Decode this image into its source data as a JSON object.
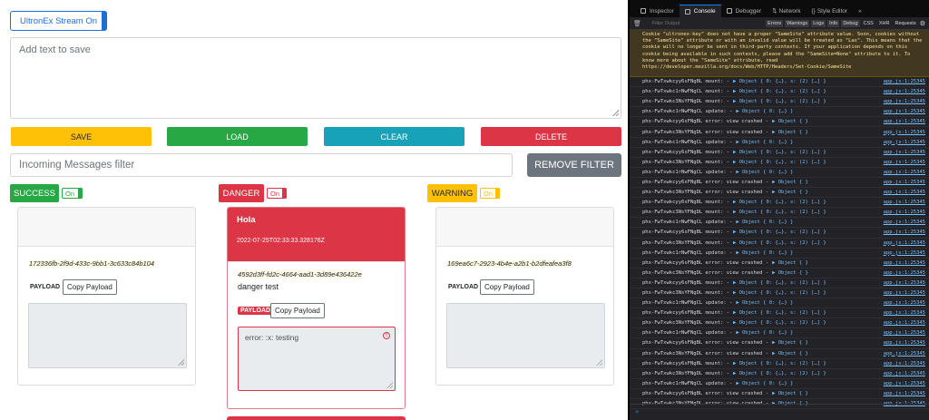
{
  "app": {
    "stream_toggle": "UltronEx Stream On",
    "text_placeholder": "Add text to save",
    "buttons": {
      "save": "SAVE",
      "load": "LOAD",
      "clear": "CLEAR",
      "delete": "DELETE",
      "remove_filter": "REMOVE FILTER"
    },
    "filter_placeholder": "Incoming Messages filter",
    "columns": {
      "success": {
        "label": "SUCCESS",
        "toggle": "On",
        "uuid": "172336fb-2f9d-433c-9bb1-3c633c84b104",
        "payload_label": "PAYLOAD",
        "copy": "Copy Payload"
      },
      "danger": {
        "label": "DANGER",
        "toggle": "On",
        "title": "Hola",
        "date": "2022-07-25T02:33:33.328176Z",
        "uuid": "4592d3ff-fd2c-4664-aad1-3d89e436422e",
        "message": "danger test",
        "payload_label": "PAYLOAD",
        "copy": "Copy Payload",
        "error_text": "error: :x: testing"
      },
      "warning": {
        "label": "WARNING",
        "toggle": "On",
        "uuid": "169ea6c7-2923-4b4e-a2b1-b2dfeafea3f8",
        "payload_label": "PAYLOAD",
        "copy": "Copy Payload"
      }
    }
  },
  "devtools": {
    "tabs": [
      "Inspector",
      "Console",
      "Debugger",
      "Network",
      "Style Editor"
    ],
    "filter_placeholder": "Filter Output",
    "levels": [
      "Errors",
      "Warnings",
      "Logs",
      "Info",
      "Debug"
    ],
    "extra": [
      "CSS",
      "XHR",
      "Requests"
    ],
    "warning": "Cookie \"ultronex-key\" does not have a proper \"SameSite\" attribute value. Soon, cookies without the \"SameSite\" attribute or with an invalid value will be treated as \"Lax\". This means that the cookie will no longer be sent in third-party contexts. If your application depends on this cookie being available in such contexts, please add the \"SameSite=None\" attribute to it. To know more about the \"SameSite\" attribute, read https://developer.mozilla.org/docs/Web/HTTP/Headers/Set-Cookie/SameSite",
    "rows": [
      [
        "phx-FwTxwkcyy6sFNgBL mount:  -",
        "▶ Object { 0: {…}, s: (2) […] }"
      ],
      [
        "phx-FwTxwkc1rNwFNgCL mount:  -",
        "▶ Object { 0: {…}, s: (2) […] }"
      ],
      [
        "phx-FwTxwkc3NsYFNgDL mount:  -",
        "▶ Object { 0: {…}, s: (2) […] }"
      ],
      [
        "phx-FwTxwkc1rNwFNgCL update:  -",
        "▶ Object { 0: {…} }"
      ],
      [
        "phx-FwTxwkcyy6sFNgBL error: view crashed -",
        "▶ Object {  }"
      ],
      [
        "phx-FwTxwkc3NsYFNgDL error: view crashed -",
        "▶ Object {  }"
      ],
      [
        "phx-FwTxwkc1rNwFNgCL update:  -",
        "▶ Object { 0: {…} }"
      ],
      [
        "phx-FwTxwkcyy6sFNgBL mount:  -",
        "▶ Object { 0: {…}, s: (2) […] }"
      ],
      [
        "phx-FwTxwkc3NsYFNgDL mount:  -",
        "▶ Object { 0: {…}, s: (2) […] }"
      ],
      [
        "phx-FwTxwkc1rNwFNgCL update:  -",
        "▶ Object { 0: {…} }"
      ],
      [
        "phx-FwTxwkcyy6sFNgBL error: view crashed -",
        "▶ Object {  }"
      ],
      [
        "phx-FwTxwkc3NsYFNgDL error: view crashed -",
        "▶ Object {  }"
      ],
      [
        "phx-FwTxwkcyy6sFNgBL mount:  -",
        "▶ Object { 0: {…}, s: (2) […] }"
      ],
      [
        "phx-FwTxwkc3NsYFNgDL mount:  -",
        "▶ Object { 0: {…}, s: (2) […] }"
      ],
      [
        "phx-FwTxwkc1rNwFNgCL update:  -",
        "▶ Object { 0: {…} }"
      ],
      [
        "phx-FwTxwkcyy6sFNgBL mount:  -",
        "▶ Object { 0: {…}, s: (2) […] }"
      ],
      [
        "phx-FwTxwkc3NsYFNgDL mount:  -",
        "▶ Object { 0: {…}, s: (2) […] }"
      ],
      [
        "phx-FwTxwkc1rNwFNgCL update:  -",
        "▶ Object { 0: {…} }"
      ],
      [
        "phx-FwTxwkcyy6sFNgBL error: view crashed -",
        "▶ Object {  }"
      ],
      [
        "phx-FwTxwkc3NsYFNgDL error: view crashed -",
        "▶ Object {  }"
      ],
      [
        "phx-FwTxwkcyy6sFNgBL mount:  -",
        "▶ Object { 0: {…}, s: (2) […] }"
      ],
      [
        "phx-FwTxwkc3NsYFNgDL mount:  -",
        "▶ Object { 0: {…}, s: (2) […] }"
      ],
      [
        "phx-FwTxwkc1rNwFNgCL update:  -",
        "▶ Object { 0: {…} }"
      ],
      [
        "phx-FwTxwkcyy6sFNgBL mount:  -",
        "▶ Object { 0: {…}, s: (2) […] }"
      ],
      [
        "phx-FwTxwkc3NsYFNgDL mount:  -",
        "▶ Object { 0: {…}, s: (2) […] }"
      ],
      [
        "phx-FwTxwkc1rNwFNgCL update:  -",
        "▶ Object { 0: {…} }"
      ],
      [
        "phx-FwTxwkcyy6sFNgBL error: view crashed -",
        "▶ Object {  }"
      ],
      [
        "phx-FwTxwkc3NsYFNgDL error: view crashed -",
        "▶ Object {  }"
      ],
      [
        "phx-FwTxwkcyy6sFNgBL mount:  -",
        "▶ Object { 0: {…}, s: (2) […] }"
      ],
      [
        "phx-FwTxwkc3NsYFNgDL mount:  -",
        "▶ Object { 0: {…}, s: (2) […] }"
      ],
      [
        "phx-FwTxwkc1rNwFNgCL update:  -",
        "▶ Object { 0: {…} }"
      ],
      [
        "phx-FwTxwkcyy6sFNgBL error: view crashed -",
        "▶ Object {  }"
      ],
      [
        "phx-FwTxwkc3NsYFNgDL error: view crashed -",
        "▶ Object {  }"
      ]
    ],
    "source": "app.js:1:25345"
  }
}
